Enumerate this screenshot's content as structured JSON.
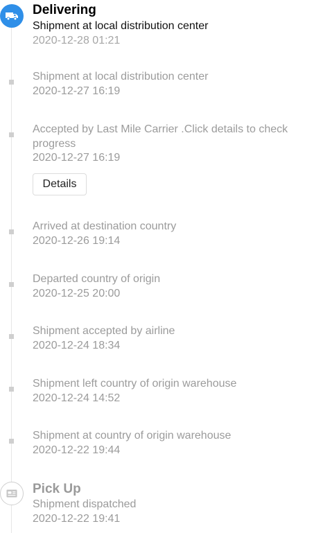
{
  "colors": {
    "accent": "#2f8fe8",
    "rail": "#e6e6e6",
    "muted_text": "#9b9b9b",
    "dot": "#cfcfcf"
  },
  "timeline": {
    "events": [
      {
        "status": "Delivering",
        "icon": "truck-icon",
        "description": "Shipment at local distribution center",
        "time": "2020-12-28 01:21",
        "current": true
      },
      {
        "description": "Shipment at local distribution center",
        "time": "2020-12-27 16:19"
      },
      {
        "description": "Accepted by Last Mile Carrier .Click details to check progress",
        "time": "2020-12-27 16:19",
        "button": "Details"
      },
      {
        "description": "Arrived at destination country",
        "time": "2020-12-26 19:14"
      },
      {
        "description": "Departed country of origin",
        "time": "2020-12-25 20:00"
      },
      {
        "description": "Shipment accepted by airline",
        "time": "2020-12-24 18:34"
      },
      {
        "description": "Shipment left country of origin warehouse",
        "time": "2020-12-24 14:52"
      },
      {
        "description": "Shipment at country of origin warehouse",
        "time": "2020-12-22 19:44"
      },
      {
        "status": "Pick Up",
        "icon": "package-card-icon",
        "description": "Shipment dispatched",
        "time": "2020-12-22 19:41"
      }
    ]
  }
}
